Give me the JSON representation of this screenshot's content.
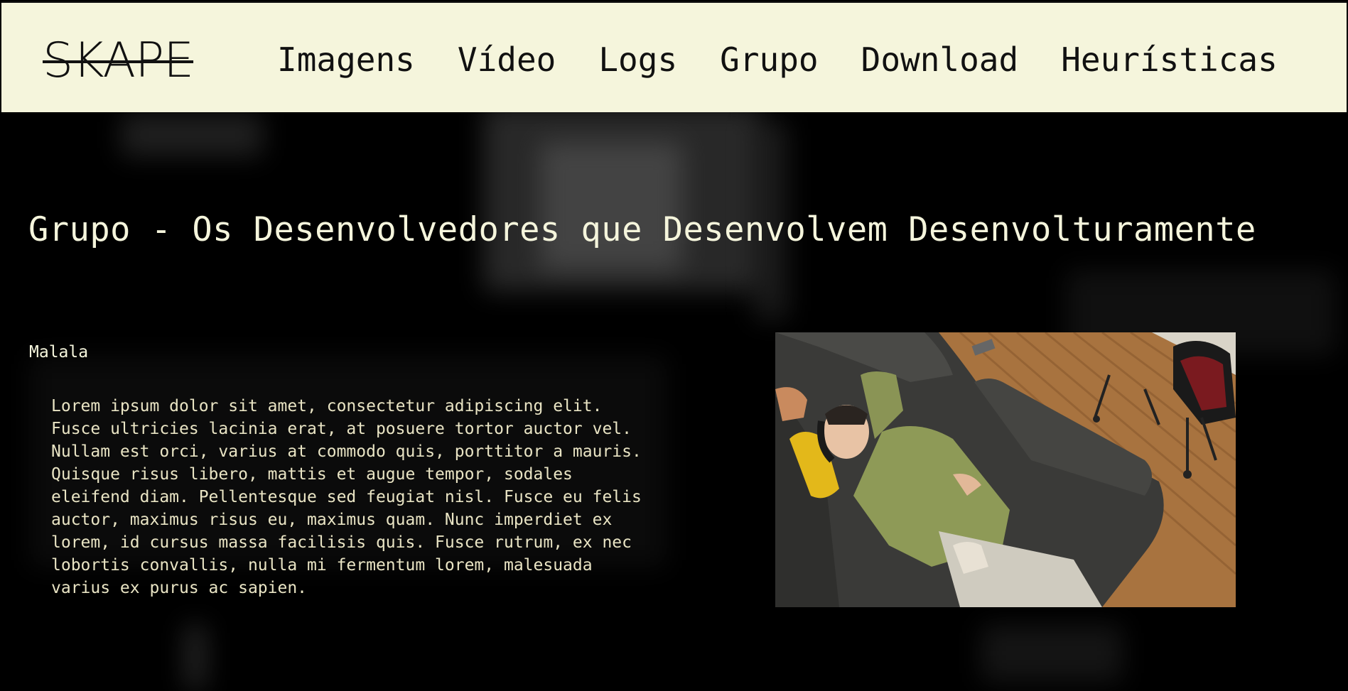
{
  "header": {
    "logo": "SKAPE",
    "nav": [
      {
        "label": "Imagens"
      },
      {
        "label": "Vídeo"
      },
      {
        "label": "Logs"
      },
      {
        "label": "Grupo"
      },
      {
        "label": "Download"
      },
      {
        "label": "Heurísticas"
      }
    ]
  },
  "main": {
    "title": "Grupo - Os Desenvolvedores que Desenvolvem Desenvolturamente",
    "member": {
      "name": "Malala",
      "bio": "Lorem ipsum dolor sit amet, consectetur adipiscing elit. Fusce ultricies lacinia erat, at posuere tortor auctor vel. Nullam est orci, varius at commodo quis, porttitor a mauris. Quisque risus libero, mattis et augue tempor, sodales eleifend diam. Pellentesque sed feugiat nisl. Fusce eu felis auctor, maximus risus eu, maximus quam. Nunc imperdiet ex lorem, id cursus massa facilisis quis. Fusce rutrum, ex nec lobortis convallis, nulla mi fermentum lorem, malesuada varius ex purus ac sapien."
    }
  },
  "colors": {
    "header_bg": "#f5f5dc",
    "page_bg": "#000000",
    "text_light": "#f5f5dc"
  }
}
